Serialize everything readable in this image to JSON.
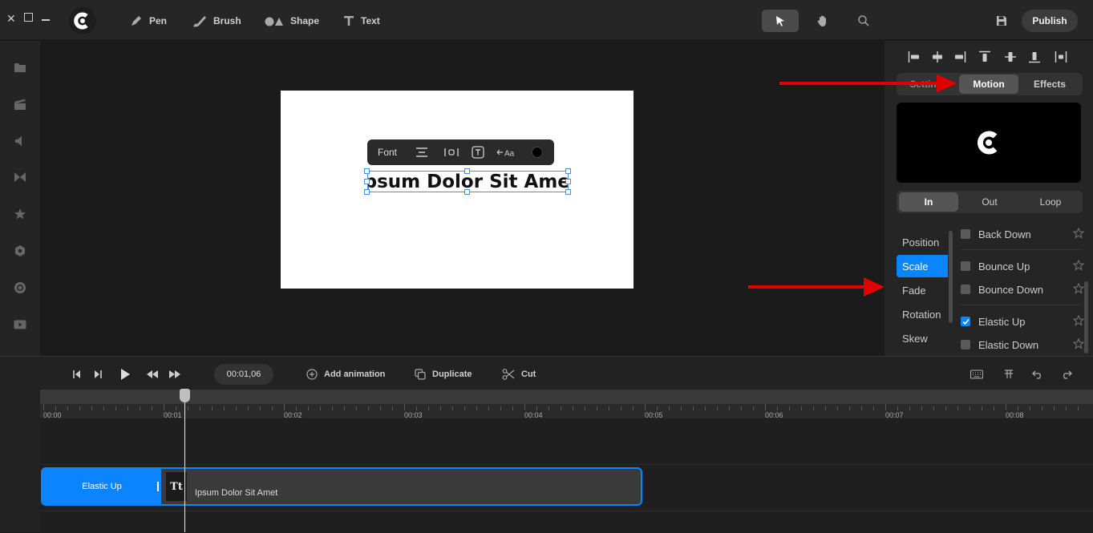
{
  "toolbar": {
    "tools": [
      {
        "label": "Pen",
        "icon": "pen-icon"
      },
      {
        "label": "Brush",
        "icon": "brush-icon"
      },
      {
        "label": "Shape",
        "icon": "shape-icon"
      },
      {
        "label": "Text",
        "icon": "text-icon"
      }
    ],
    "publish_label": "Publish"
  },
  "canvas": {
    "text_toolbar": {
      "font_label": "Font"
    },
    "selected_text": "Ipsum Dolor Sit Amet"
  },
  "right_panel": {
    "tabs": [
      {
        "label": "Settings",
        "active": false
      },
      {
        "label": "Motion",
        "active": true
      },
      {
        "label": "Effects",
        "active": false
      }
    ],
    "direction_tabs": [
      {
        "label": "In",
        "active": true
      },
      {
        "label": "Out",
        "active": false
      },
      {
        "label": "Loop",
        "active": false
      }
    ],
    "categories": [
      {
        "label": "Position",
        "active": false
      },
      {
        "label": "Scale",
        "active": true
      },
      {
        "label": "Fade",
        "active": false
      },
      {
        "label": "Rotation",
        "active": false
      },
      {
        "label": "Skew",
        "active": false
      }
    ],
    "animations": [
      {
        "label": "Back Down",
        "checked": false
      },
      {
        "label": "Bounce Up",
        "checked": false
      },
      {
        "label": "Bounce Down",
        "checked": false
      },
      {
        "label": "Elastic Up",
        "checked": true
      },
      {
        "label": "Elastic Down",
        "checked": false
      }
    ]
  },
  "timeline": {
    "timecode": "00:01,06",
    "actions": [
      {
        "label": "Add animation",
        "icon": "plus-circle-icon"
      },
      {
        "label": "Duplicate",
        "icon": "duplicate-icon"
      },
      {
        "label": "Cut",
        "icon": "scissors-icon"
      }
    ],
    "ruler_labels": [
      "00:00",
      "00:01",
      "00:02",
      "00:03",
      "00:04",
      "00:05",
      "00:06",
      "00:07",
      "00:08"
    ],
    "clip": {
      "animation_label": "Elastic Up",
      "type_badge": "Tt",
      "label": "Ipsum Dolor Sit Amet"
    }
  },
  "colors": {
    "accent": "#0a84ff",
    "annotation_arrow": "#e00000"
  }
}
